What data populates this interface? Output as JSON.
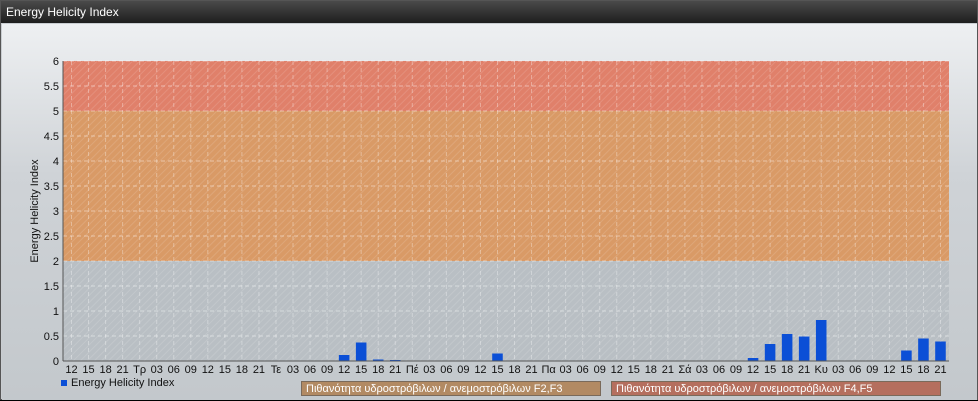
{
  "window": {
    "title": "Energy Helicity Index"
  },
  "legend": {
    "series_label": "Energy Helicity Index"
  },
  "bands": {
    "f23_label": "Πιθανότητα υδροστρόβιλων / ανεμοστρόβιλων F2,F3",
    "f45_label": "Πιθανότητα υδροστρόβιλων / ανεμοστρόβιλων F4,F5"
  },
  "colors": {
    "bar": "#0b4fd6",
    "band_low": "#b9bfc4",
    "band_mid": "#d99a66",
    "band_high": "#e0806a"
  },
  "chart_data": {
    "type": "bar",
    "ylabel": "Energy Helicity Index",
    "ylim": [
      0,
      6
    ],
    "yticks": [
      "0",
      "0.5",
      "1",
      "1.5",
      "2",
      "2.5",
      "3",
      "3.5",
      "4",
      "4.5",
      "5",
      "5.5",
      "6"
    ],
    "bands": [
      {
        "from": 0,
        "to": 2,
        "color": "#b9bfc4"
      },
      {
        "from": 2,
        "to": 5,
        "color": "#d99a66"
      },
      {
        "from": 5,
        "to": 6,
        "color": "#e0806a"
      }
    ],
    "categories": [
      "12",
      "15",
      "18",
      "21",
      "Τρ",
      "03",
      "06",
      "09",
      "12",
      "15",
      "18",
      "21",
      "Τε",
      "03",
      "06",
      "09",
      "12",
      "15",
      "18",
      "21",
      "Πέ",
      "03",
      "06",
      "09",
      "12",
      "15",
      "18",
      "21",
      "Πα",
      "03",
      "06",
      "09",
      "12",
      "15",
      "18",
      "21",
      "Σά",
      "03",
      "06",
      "09",
      "12",
      "15",
      "18",
      "21",
      "Κυ",
      "03",
      "06",
      "09",
      "12",
      "15",
      "18",
      "21"
    ],
    "values": [
      0.01,
      0.01,
      0.01,
      0.01,
      0.01,
      0.01,
      0.01,
      0.01,
      0.01,
      0.01,
      0.01,
      0.01,
      0.01,
      0.01,
      0.01,
      0.01,
      0.12,
      0.37,
      0.03,
      0.02,
      0.01,
      0.01,
      0.01,
      0.01,
      0.01,
      0.15,
      0.01,
      0.01,
      0.01,
      0.01,
      0.01,
      0.01,
      0.01,
      0.01,
      0.01,
      0.01,
      0.01,
      0.01,
      0.01,
      0.01,
      0.06,
      0.34,
      0.54,
      0.49,
      0.82,
      0.01,
      0.01,
      0.01,
      0.01,
      0.21,
      0.45,
      0.39
    ]
  }
}
